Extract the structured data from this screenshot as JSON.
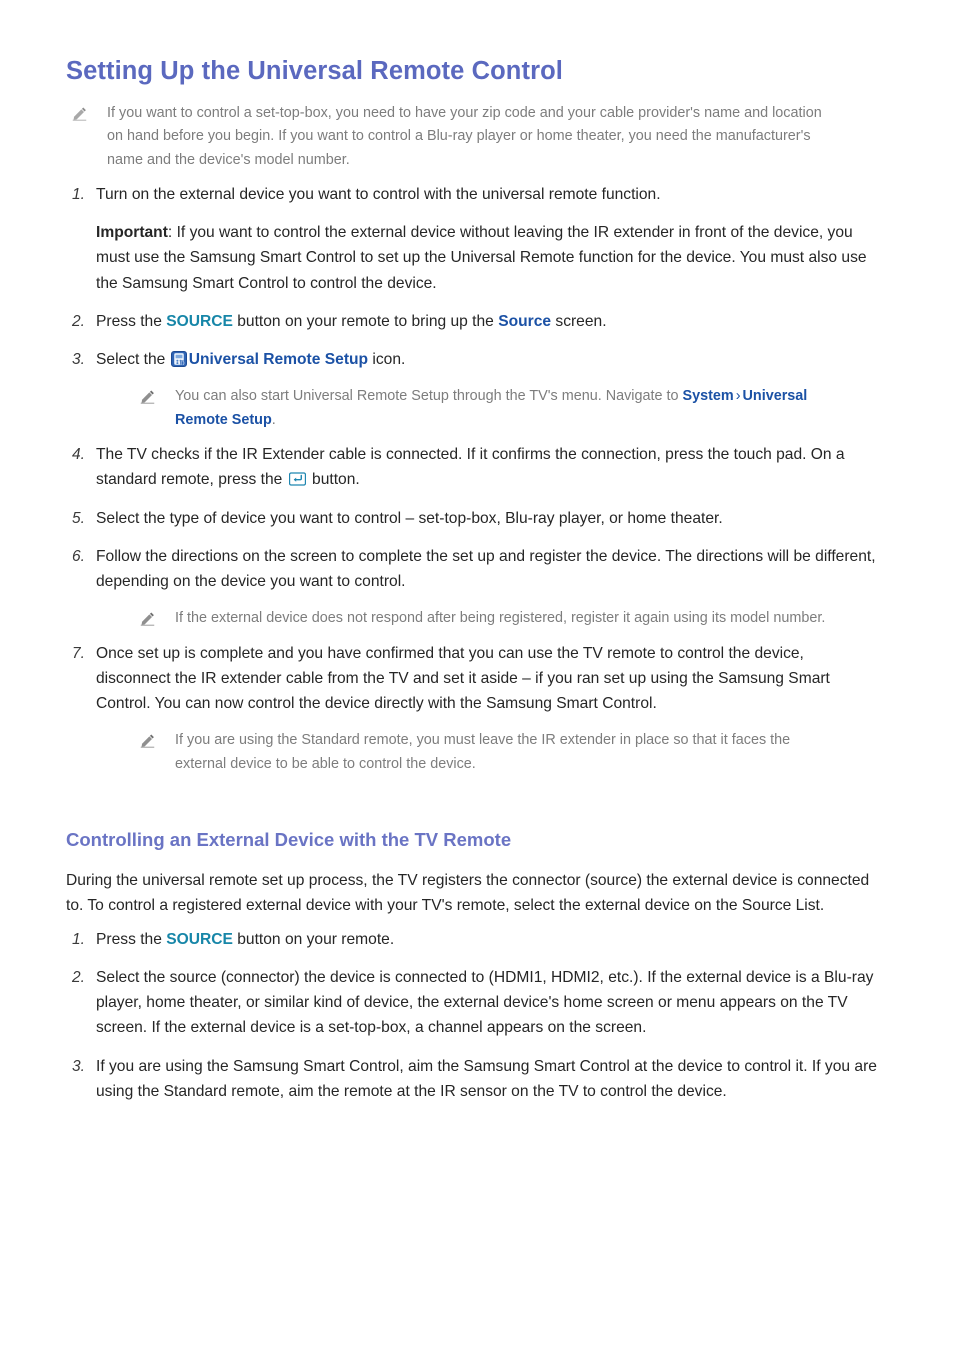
{
  "document": {
    "title": "Setting Up the Universal Remote Control",
    "intro_note": "If you want to control a set-top-box, you need to have your zip code and your cable provider's name and location on hand before you begin. If you want to control a Blu-ray player or home theater, you need the manufacturer's name and the device's model number.",
    "steps": {
      "n1": "1.",
      "n2": "2.",
      "n3": "3.",
      "n4": "4.",
      "n5": "5.",
      "n6": "6.",
      "n7": "7."
    },
    "step1": {
      "text": "Turn on the external device you want to control with the universal remote function.",
      "important_label": "Important",
      "important_text": ": If you want to control the external device without leaving the IR extender in front of the device, you must use the Samsung Smart Control to set up the Universal Remote function for the device. You must also use the Samsung Smart Control to control the device."
    },
    "step2": {
      "pre": "Press the ",
      "source_key": "SOURCE",
      "mid": " button on your remote to bring up the ",
      "source_screen": "Source",
      "post": " screen."
    },
    "step3": {
      "pre": "Select the ",
      "icon": "universal-remote-setup-icon",
      "link": "Universal Remote Setup",
      "post": " icon.",
      "note_pre": "You can also start Universal Remote Setup through the TV's menu. Navigate to ",
      "note_menu1": "System",
      "note_sep": "›",
      "note_menu2": "Universal Remote Setup",
      "note_post": "."
    },
    "step4": {
      "pre": "The TV checks if the IR Extender cable is connected. If it confirms the connection, press the touch pad. On a standard remote, press the ",
      "icon": "enter-key-icon",
      "post": " button."
    },
    "step5": {
      "text": "Select the type of device you want to control – set-top-box, Blu-ray player, or home theater."
    },
    "step6": {
      "text": "Follow the directions on the screen to complete the set up and register the device. The directions will be different, depending on the device you want to control.",
      "note": "If the external device does not respond after being registered, register it again using its model number."
    },
    "step7": {
      "text": "Once set up is complete and you have confirmed that you can use the TV remote to control the device, disconnect the IR extender cable from the TV and set it aside – if you ran set up using the Samsung Smart Control. You can now control the device directly with the Samsung Smart Control.",
      "note": "If you are using the Standard remote, you must leave the IR extender in place so that it faces the external device to be able to control the device."
    },
    "section2": {
      "heading": "Controlling an External Device with the TV Remote",
      "intro": "During the universal remote set up process, the TV registers the connector (source) the external device is connected to. To control a registered external device with your TV's remote, select the external device on the Source List.",
      "steps": {
        "n1": "1.",
        "n2": "2.",
        "n3": "3."
      },
      "step1": {
        "pre": "Press the ",
        "source_key": "SOURCE",
        "post": " button on your remote."
      },
      "step2": {
        "text": "Select the source (connector) the device is connected to (HDMI1, HDMI2, etc.). If the external device is a Blu-ray player, home theater, or similar kind of device, the external device's home screen or menu appears on the TV screen. If the external device is a set-top-box, a channel appears on the screen."
      },
      "step3": {
        "text": "If you are using the Samsung Smart Control, aim the Samsung Smart Control at the device to control it. If you are using the Standard remote, aim the remote at the IR sensor on the TV to control the device."
      }
    }
  },
  "colors": {
    "heading_primary": "#5b69bf",
    "heading_secondary": "#6a74c4",
    "source_key": "#1786a8",
    "link_blue": "#1b51a5",
    "note_gray": "#7d7d7d",
    "body_text": "#262626",
    "page_background": "#ffffff"
  }
}
